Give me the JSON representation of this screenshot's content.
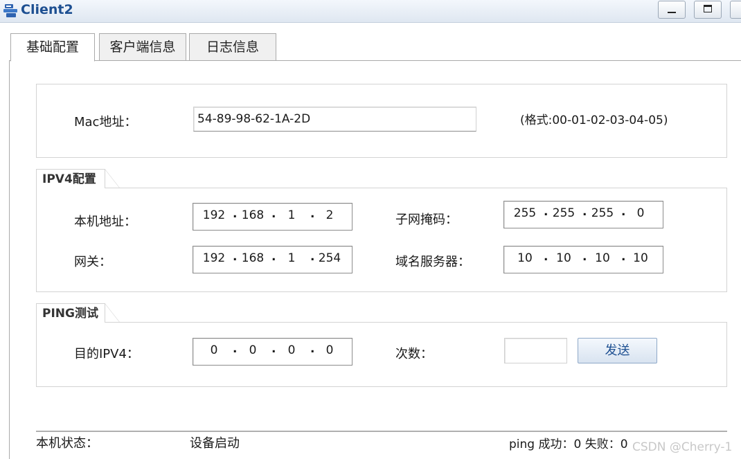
{
  "window": {
    "title": "Client2"
  },
  "tabs": [
    {
      "label": "基础配置",
      "active": true
    },
    {
      "label": "客户端信息",
      "active": false
    },
    {
      "label": "日志信息",
      "active": false
    }
  ],
  "mac": {
    "label": "Mac地址：",
    "value": "54-89-98-62-1A-2D",
    "format_hint": "(格式:00-01-02-03-04-05)"
  },
  "ipv4": {
    "group_title": "IPV4配置",
    "local_address": {
      "label": "本机地址：",
      "octets": [
        "192",
        "168",
        "1",
        "2"
      ]
    },
    "subnet_mask": {
      "label": "子网掩码：",
      "octets": [
        "255",
        "255",
        "255",
        "0"
      ]
    },
    "gateway": {
      "label": "网关：",
      "octets": [
        "192",
        "168",
        "1",
        "254"
      ]
    },
    "dns_server": {
      "label": "域名服务器：",
      "octets": [
        "10",
        "10",
        "10",
        "10"
      ]
    }
  },
  "ping": {
    "group_title": "PING测试",
    "dest_label": "目的IPV4：",
    "dest_octets": [
      "0",
      "0",
      "0",
      "0"
    ],
    "count_label": "次数：",
    "count_value": "",
    "send_label": "发送"
  },
  "status": {
    "label": "本机状态：",
    "value": "设备启动",
    "ping_result": "ping 成功：0 失败：0"
  },
  "watermark": "CSDN @Cherry-1",
  "colors": {
    "title": "#1d4f91",
    "border": "#a9a9a9",
    "button_text": "#1d4f91"
  }
}
